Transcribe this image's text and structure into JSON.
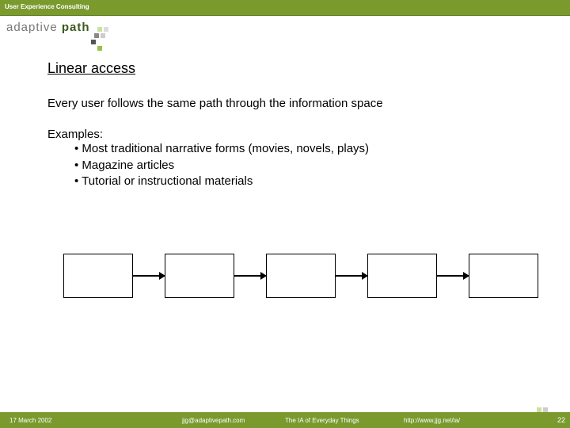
{
  "header": {
    "tagline": "User Experience Consulting"
  },
  "logo": {
    "part1": "adaptive ",
    "part2": "path"
  },
  "slide": {
    "title": "Linear access",
    "body": "Every user follows the same path through the information space",
    "examples_label": "Examples:",
    "examples": [
      "Most traditional narrative forms (movies, novels, plays)",
      "Magazine articles",
      "Tutorial or instructional materials"
    ]
  },
  "footer": {
    "date": "17 March 2002",
    "email": "jjg@adaptivepath.com",
    "talk_title": "The IA of Everyday Things",
    "url": "http://www.jjg.net/ia/",
    "page": "22"
  }
}
